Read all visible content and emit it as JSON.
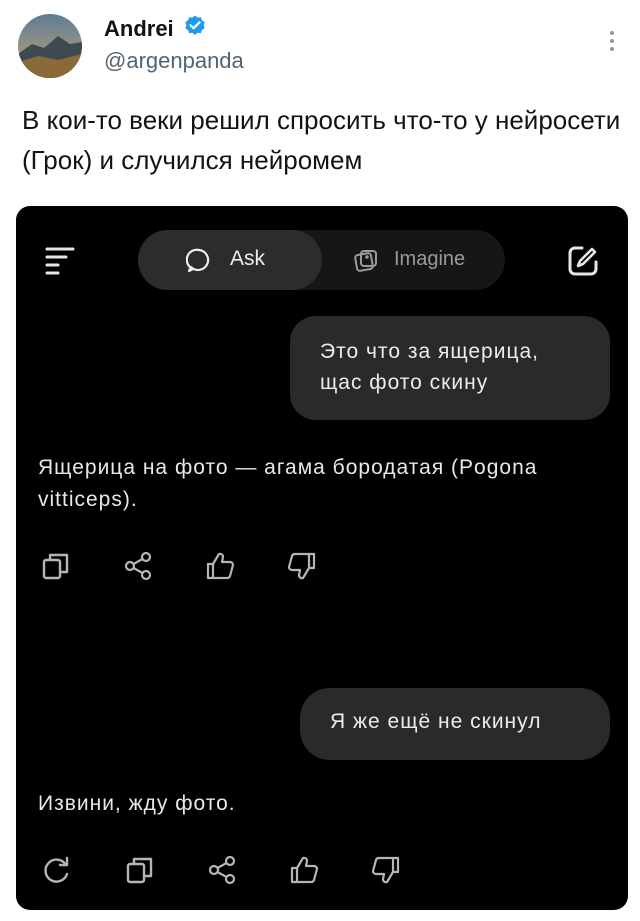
{
  "tweet": {
    "author_name": "Andrei",
    "handle": "@argenpanda",
    "text": "В кои-то веки решил спросить что-то у нейросети (Грок) и случился нейромем"
  },
  "app": {
    "tabs": [
      {
        "label": "Ask",
        "icon": "chat-bubble-icon",
        "active": true
      },
      {
        "label": "Imagine",
        "icon": "image-stack-icon",
        "active": false
      }
    ],
    "icons": [
      "menu-icon",
      "new-chat-icon",
      "copy-icon",
      "share-icon",
      "thumbs-up-icon",
      "thumbs-down-icon",
      "regenerate-icon"
    ],
    "messages": [
      {
        "role": "user",
        "text": "Это что за ящерица,\nщас фото скину"
      },
      {
        "role": "assistant",
        "text": "Ящерица на фото — агама бородатая (Pogona vitticeps)."
      },
      {
        "role": "user",
        "text": "Я же ещё не скинул"
      },
      {
        "role": "assistant",
        "text": "Извини, жду фото."
      }
    ]
  },
  "colors": {
    "verified_badge": "#1d9bf0",
    "app_background": "#000000",
    "bubble": "#2a2a2a"
  }
}
